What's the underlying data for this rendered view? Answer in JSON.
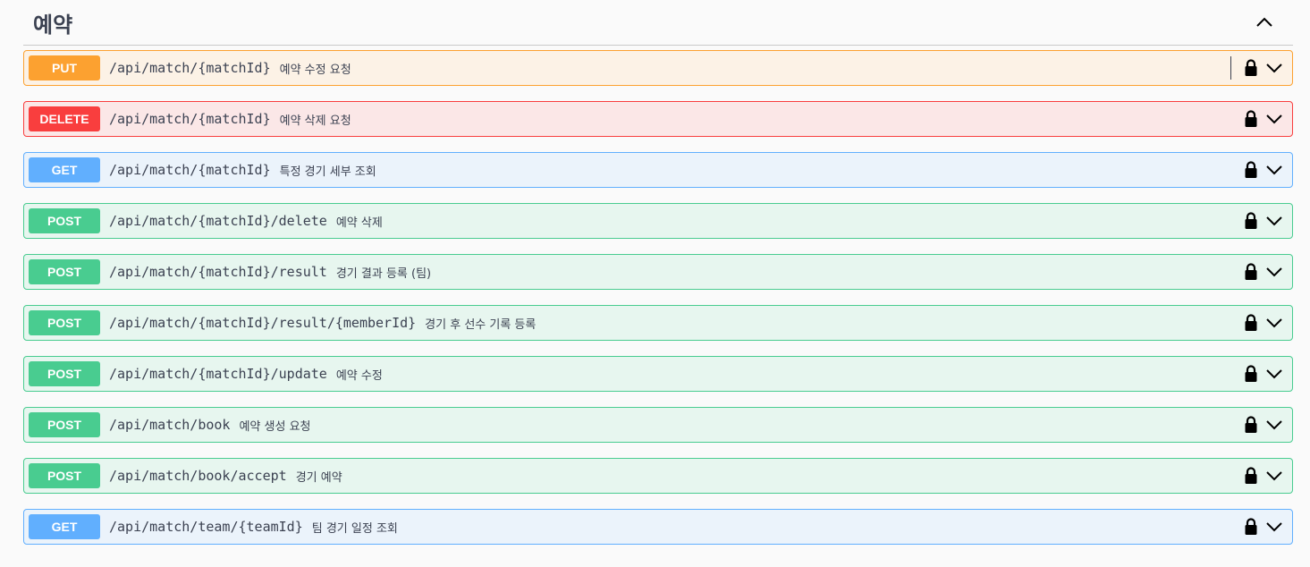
{
  "section": {
    "title": "예약"
  },
  "operations": [
    {
      "method": "PUT",
      "kind": "put",
      "path": "/api/match/{matchId}",
      "summary": "예약 수정 요청",
      "divider": true
    },
    {
      "method": "DELETE",
      "kind": "delete",
      "path": "/api/match/{matchId}",
      "summary": "예약 삭제 요청"
    },
    {
      "method": "GET",
      "kind": "get",
      "path": "/api/match/{matchId}",
      "summary": "특정 경기 세부 조회"
    },
    {
      "method": "POST",
      "kind": "post",
      "path": "/api/match/{matchId}/delete",
      "summary": "예약 삭제"
    },
    {
      "method": "POST",
      "kind": "post",
      "path": "/api/match/{matchId}/result",
      "summary": "경기 결과 등록 (팀)"
    },
    {
      "method": "POST",
      "kind": "post",
      "path": "/api/match/{matchId}/result/{memberId}",
      "summary": "경기 후 선수 기록 등록"
    },
    {
      "method": "POST",
      "kind": "post",
      "path": "/api/match/{matchId}/update",
      "summary": "예약 수정"
    },
    {
      "method": "POST",
      "kind": "post",
      "path": "/api/match/book",
      "summary": "예약 생성 요청"
    },
    {
      "method": "POST",
      "kind": "post",
      "path": "/api/match/book/accept",
      "summary": "경기 예약"
    },
    {
      "method": "GET",
      "kind": "get",
      "path": "/api/match/team/{teamId}",
      "summary": "팀 경기 일정 조회"
    }
  ],
  "icons": {
    "collapse": "chevron-up-icon",
    "lock": "lock-icon",
    "expand": "chevron-down-icon"
  },
  "colors": {
    "put": "#fca130",
    "delete": "#f93e3e",
    "get": "#61affe",
    "post": "#49cc90",
    "text": "#3b4151"
  }
}
